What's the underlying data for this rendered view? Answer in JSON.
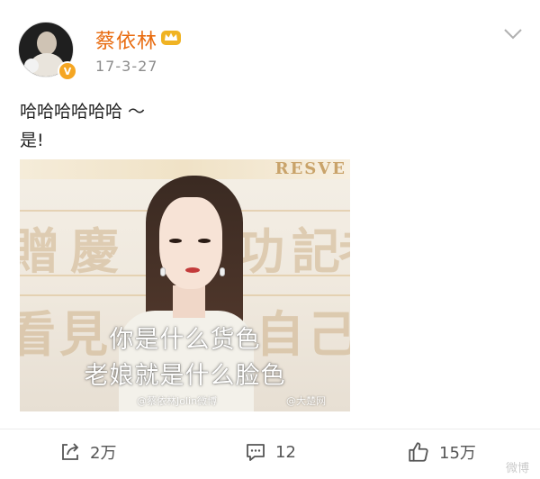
{
  "post": {
    "username": "蔡依林",
    "timestamp": "17-3-27",
    "text_lines": [
      "哈哈哈哈哈哈 ～",
      "是!"
    ],
    "image": {
      "background_top_text": "RESVE",
      "background_chars": [
        "贈",
        "慶",
        "功",
        "記",
        "者",
        "看",
        "見",
        "自",
        "己"
      ],
      "caption_lines": [
        "你是什么货色",
        "老娘就是什么脸色"
      ],
      "watermarks": [
        "@蔡依林Jolin微博",
        "@大楚网"
      ]
    }
  },
  "actions": {
    "repost_count": "2万",
    "comment_count": "12",
    "like_count": "15万"
  },
  "corner_watermark": "微博",
  "colors": {
    "username": "#e86b0f",
    "verified_badge": "#f5a623",
    "crown": "#f0b323",
    "timestamp": "#8c8c8c",
    "action_text": "#555555"
  },
  "icons": {
    "verified": "verified-badge-icon",
    "crown": "vip-crown-icon",
    "menu": "chevron-down-icon",
    "repost": "repost-icon",
    "comment": "comment-icon",
    "like": "thumbs-up-icon"
  }
}
